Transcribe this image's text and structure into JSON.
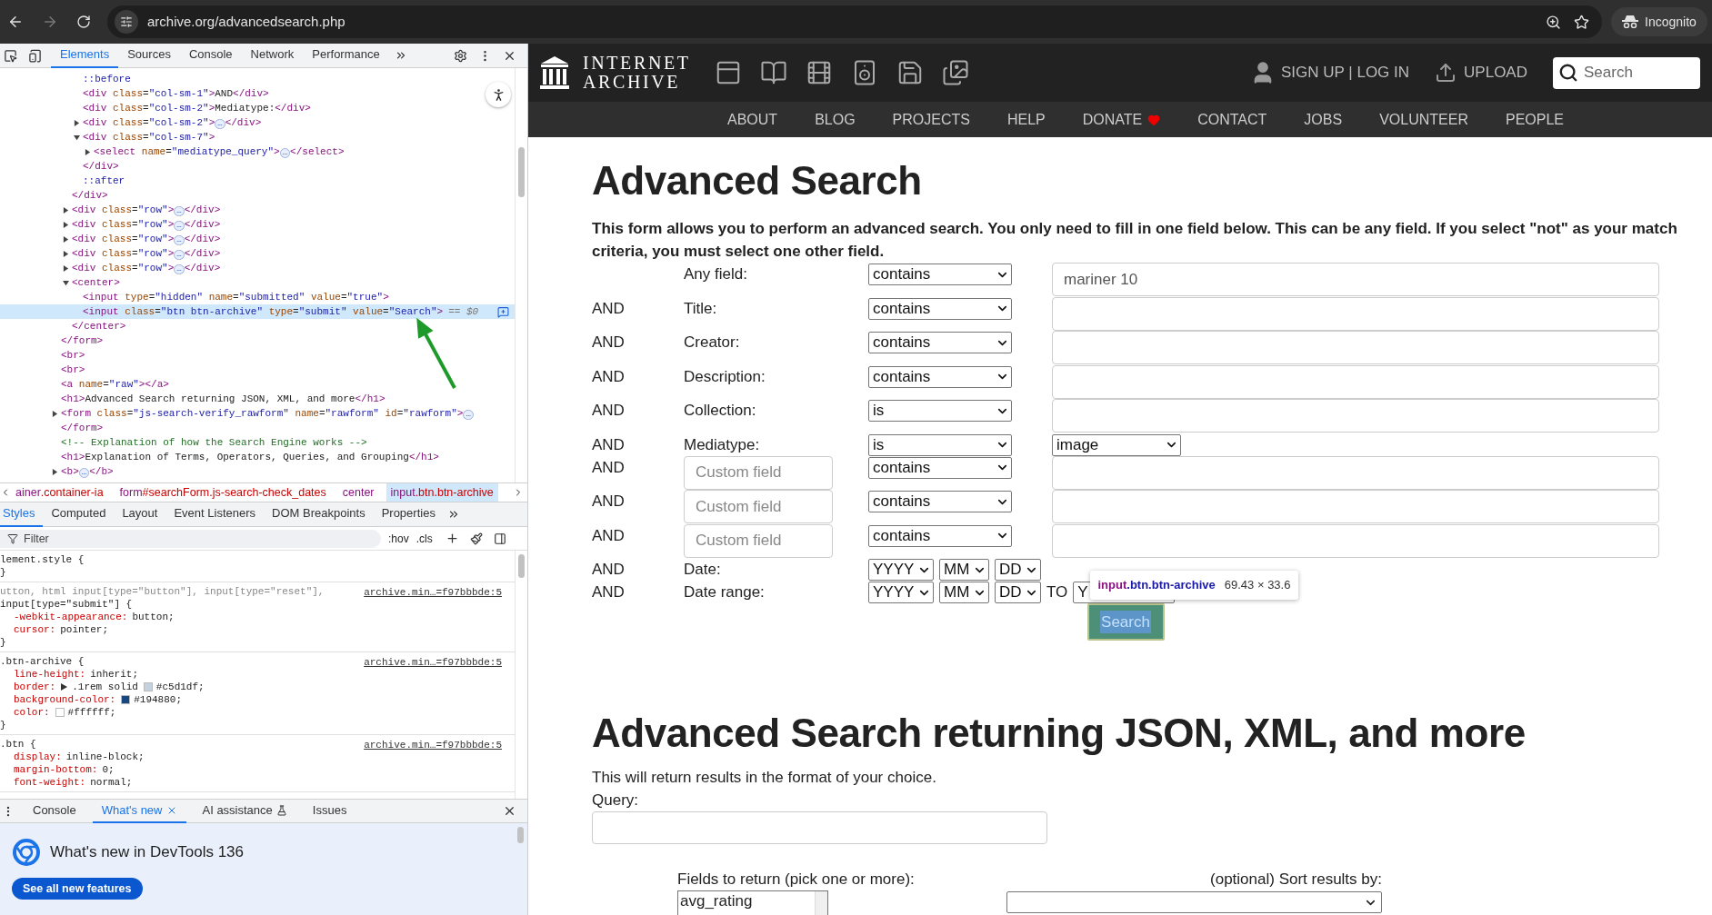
{
  "browser": {
    "url": "archive.org/advancedsearch.php",
    "profile": "Incognito"
  },
  "devtools": {
    "tabs": [
      {
        "label": "Elements",
        "selected": true
      },
      {
        "label": "Sources",
        "selected": false
      },
      {
        "label": "Console",
        "selected": false
      },
      {
        "label": "Network",
        "selected": false
      },
      {
        "label": "Performance",
        "selected": false
      }
    ],
    "dom_tree": [
      {
        "kind": "hidden",
        "children": [
          {
            "kind": "hidden",
            "children": [
              {
                "kind": "pseudo",
                "text": "::before",
                "selected": false
              },
              {
                "kind": "tag",
                "text": "<div class=\"col-sm-1\">AND</div>",
                "selected": false
              },
              {
                "kind": "tag",
                "text": "<div class=\"col-sm-2\">Mediatype:</div>",
                "selected": false
              },
              {
                "kind": "tag",
                "text": "<div class=\"col-sm-2\">…</div>",
                "expanded": false,
                "selected": false
              },
              {
                "kind": "tag",
                "text": "<div class=\"col-sm-7\">",
                "expanded": true,
                "selected": false,
                "children": [
                  {
                    "kind": "tag",
                    "text": "<select name=\"mediatype_query\">…</select>",
                    "expanded": false,
                    "selected": false
                  }
                ]
              },
              {
                "kind": "tag",
                "text": "</div>",
                "selected": false
              },
              {
                "kind": "pseudo",
                "text": "::after",
                "selected": false
              }
            ]
          },
          {
            "kind": "tag",
            "text": "</div>",
            "selected": false
          },
          {
            "kind": "tag",
            "text": "<div class=\"row\">…</div>",
            "expanded": false,
            "selected": false
          },
          {
            "kind": "tag",
            "text": "<div class=\"row\">…</div>",
            "expanded": false,
            "selected": false
          },
          {
            "kind": "tag",
            "text": "<div class=\"row\">…</div>",
            "expanded": false,
            "selected": false
          },
          {
            "kind": "tag",
            "text": "<div class=\"row\">…</div>",
            "expanded": false,
            "selected": false
          },
          {
            "kind": "tag",
            "text": "<div class=\"row\">…</div>",
            "expanded": false,
            "selected": false
          },
          {
            "kind": "tag",
            "text": "<center>",
            "expanded": true,
            "selected": false,
            "children": [
              {
                "kind": "tag",
                "text": "<input type=\"hidden\" name=\"submitted\" value=\"true\">",
                "selected": false
              },
              {
                "kind": "tag",
                "text": "<input class=\"btn btn-archive\" type=\"submit\" value=\"Search\">",
                "marker": "== $0",
                "selected": true
              }
            ]
          },
          {
            "kind": "tag",
            "text": "</center>",
            "selected": false
          }
        ]
      },
      {
        "kind": "tag",
        "text": "</form>",
        "selected": false
      },
      {
        "kind": "tag",
        "text": "<br>",
        "selected": false
      },
      {
        "kind": "tag",
        "text": "<br>",
        "selected": false
      },
      {
        "kind": "tag",
        "text": "<a name=\"raw\"></a>",
        "selected": false
      },
      {
        "kind": "tag",
        "text": "<h1>Advanced Search returning JSON, XML, and more</h1>",
        "selected": false
      },
      {
        "kind": "tag",
        "text": "<form class=\"js-search-verify_rawform\" name=\"rawform\" id=\"rawform\">…",
        "expanded": false,
        "selected": false
      },
      {
        "kind": "tag",
        "text": "</form>",
        "selected": false
      },
      {
        "kind": "comment",
        "text": "<!-- Explanation of how the Search Engine works -->",
        "selected": false
      },
      {
        "kind": "tag",
        "text": "<h1>Explanation of Terms, Operators, Queries, and Grouping</h1>",
        "selected": false
      },
      {
        "kind": "tag",
        "text": "<b>…</b>",
        "expanded": false,
        "selected": false
      }
    ],
    "breadcrumbs": [
      {
        "label": "ainer.container-ia",
        "selected": false
      },
      {
        "label": "form#searchForm.js-search-check_dates",
        "selected": false
      },
      {
        "label": "center",
        "selected": false
      },
      {
        "label": "input.btn.btn-archive",
        "selected": true
      }
    ],
    "sidebar_tabs": [
      {
        "label": "Styles",
        "selected": true
      },
      {
        "label": "Computed",
        "selected": false
      },
      {
        "label": "Layout",
        "selected": false
      },
      {
        "label": "Event Listeners",
        "selected": false
      },
      {
        "label": "DOM Breakpoints",
        "selected": false
      },
      {
        "label": "Properties",
        "selected": false
      }
    ],
    "filter": {
      "placeholder": "Filter"
    },
    "filter_buttons": [
      ":hov",
      ".cls"
    ],
    "rules": [
      {
        "selector": [
          {
            "text": "lement.style {",
            "matched": true
          }
        ],
        "close": "}"
      },
      {
        "selector": [
          {
            "text": "utton, html input[type=\"button\"], input[type=\"reset\"],",
            "matched": false
          },
          {
            "text": "input[type=\"submit\"] {",
            "matched": true
          }
        ],
        "source": "archive.min…=f97bbbde:5",
        "declarations": [
          {
            "property": "-webkit-appearance:",
            "value": "button;"
          },
          {
            "property": "cursor:",
            "value": "pointer;"
          }
        ],
        "close": "}"
      },
      {
        "selector": [
          {
            "text": ".btn-archive {",
            "matched": true
          }
        ],
        "source": "archive.min…=f97bbbde:5",
        "declarations": [
          {
            "property": "line-height:",
            "value": "inherit;"
          },
          {
            "property": "border:",
            "expandable": true,
            "value_before": ".1rem solid",
            "color": "#c5d1df",
            "value": "#c5d1df;"
          },
          {
            "property": "background-color:",
            "color": "#194880",
            "value": "#194880;"
          },
          {
            "property": "color:",
            "color": "#ffffff",
            "value": "#ffffff;"
          }
        ],
        "close": "}"
      },
      {
        "selector": [
          {
            "text": ".btn {",
            "matched": true
          }
        ],
        "source": "archive.min…=f97bbbde:5",
        "declarations": [
          {
            "property": "display:",
            "value": "inline-block;"
          },
          {
            "property": "margin-bottom:",
            "value": "0;"
          },
          {
            "property": "font-weight:",
            "value": "normal;"
          }
        ]
      }
    ],
    "drawer_tabs": [
      {
        "label": "Console",
        "selected": false
      },
      {
        "label": "What's new",
        "selected": true,
        "closable": true
      },
      {
        "label": "AI assistance",
        "selected": false,
        "experimental": true
      },
      {
        "label": "Issues",
        "selected": false
      }
    ],
    "whats_new": {
      "title": "What's new in DevTools 136",
      "button": "See all new features"
    }
  },
  "site": {
    "logo": [
      "INTERNET",
      "ARCHIVE"
    ],
    "account": "SIGN UP | LOG IN",
    "upload": "UPLOAD",
    "search": {
      "placeholder": "Search"
    },
    "menu": [
      {
        "label": "ABOUT"
      },
      {
        "label": "BLOG"
      },
      {
        "label": "PROJECTS"
      },
      {
        "label": "HELP"
      },
      {
        "label": "DONATE",
        "heart": true
      },
      {
        "label": "CONTACT"
      },
      {
        "label": "JOBS"
      },
      {
        "label": "VOLUNTEER"
      },
      {
        "label": "PEOPLE"
      }
    ]
  },
  "page": {
    "title": "Advanced Search",
    "intro": "This form allows you to perform an advanced search. You only need to fill in one field below. This can be any field. If you select \"not\" as your match criteria, you must select one other field.",
    "rows": [
      {
        "kind": "text",
        "label": "Any field:",
        "operator": "contains",
        "value": "mariner 10"
      },
      {
        "kind": "text",
        "conjunction": "AND",
        "label": "Title:",
        "operator": "contains"
      },
      {
        "kind": "text",
        "conjunction": "AND",
        "label": "Creator:",
        "operator": "contains"
      },
      {
        "kind": "text",
        "conjunction": "AND",
        "label": "Description:",
        "operator": "contains"
      },
      {
        "kind": "text",
        "conjunction": "AND",
        "label": "Collection:",
        "operator": "is"
      },
      {
        "kind": "choice",
        "conjunction": "AND",
        "label": "Mediatype:",
        "operator": "is",
        "choice": "image"
      },
      {
        "kind": "custom",
        "conjunction": "AND",
        "placeholder": "Custom field",
        "operator": "contains"
      },
      {
        "kind": "custom",
        "conjunction": "AND",
        "placeholder": "Custom field",
        "operator": "contains"
      },
      {
        "kind": "custom",
        "conjunction": "AND",
        "placeholder": "Custom field",
        "operator": "contains"
      },
      {
        "kind": "date",
        "conjunction": "AND",
        "label": "Date:",
        "date": [
          "YYYY",
          "MM",
          "DD"
        ]
      },
      {
        "kind": "date_range",
        "conjunction": "AND",
        "label": "Date range:",
        "date": [
          "YYYY",
          "MM",
          "DD"
        ],
        "separator": "TO",
        "date_end": [
          "Y"
        ]
      }
    ],
    "submit": "Search",
    "inspect_tooltip": {
      "element": "input.btn.btn-archive",
      "size": "69.43 × 33.6"
    },
    "raw": {
      "title": "Advanced Search returning JSON, XML, and more",
      "intro": "This will return results in the format of your choice.",
      "query_label": "Query:",
      "fields_label": "Fields to return (pick one or more):",
      "fields_options": [
        "avg_rating"
      ],
      "sort_label": "(optional) Sort results by:"
    }
  }
}
